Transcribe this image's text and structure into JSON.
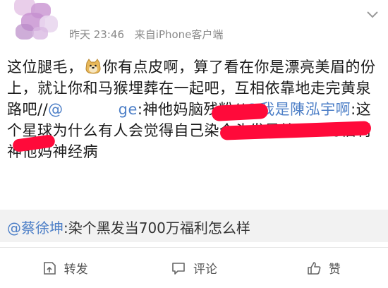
{
  "header": {
    "time": "昨天 23:46",
    "source": "来自iPhone客户端",
    "menu_icon": "chevron-down-icon",
    "avatar_icon": "blurred-avatar"
  },
  "post": {
    "line_a": "这位腿毛，",
    "emoji": "doge-emoji",
    "line_b": "你有点皮啊，算了看在你是漂亮美眉的份上，就让你和马猴埋葬在一起吧，互相依靠地走完黄泉路吧//",
    "mention_1": "@",
    "mention_1_tail": "ge",
    "line_c": ":神他妈脑残粉//",
    "mention_2": "@我是陳泓宇啊",
    "line_d": ":这个星球为什么有人会觉得自己染个头发是给别人的福利 神他妈神经病"
  },
  "quote": {
    "mention": "@蔡徐坤",
    "text": ":染个黑发当700万福利怎么样"
  },
  "actions": [
    {
      "label": "转发",
      "icon": "repost-icon"
    },
    {
      "label": "评论",
      "icon": "comment-icon"
    },
    {
      "label": "赞",
      "icon": "like-icon"
    }
  ],
  "colors": {
    "link": "#4d7fc7",
    "redaction": "#ff0a3a",
    "quote_bg": "#f2f2f2",
    "meta_gray": "#8a8a8a"
  }
}
